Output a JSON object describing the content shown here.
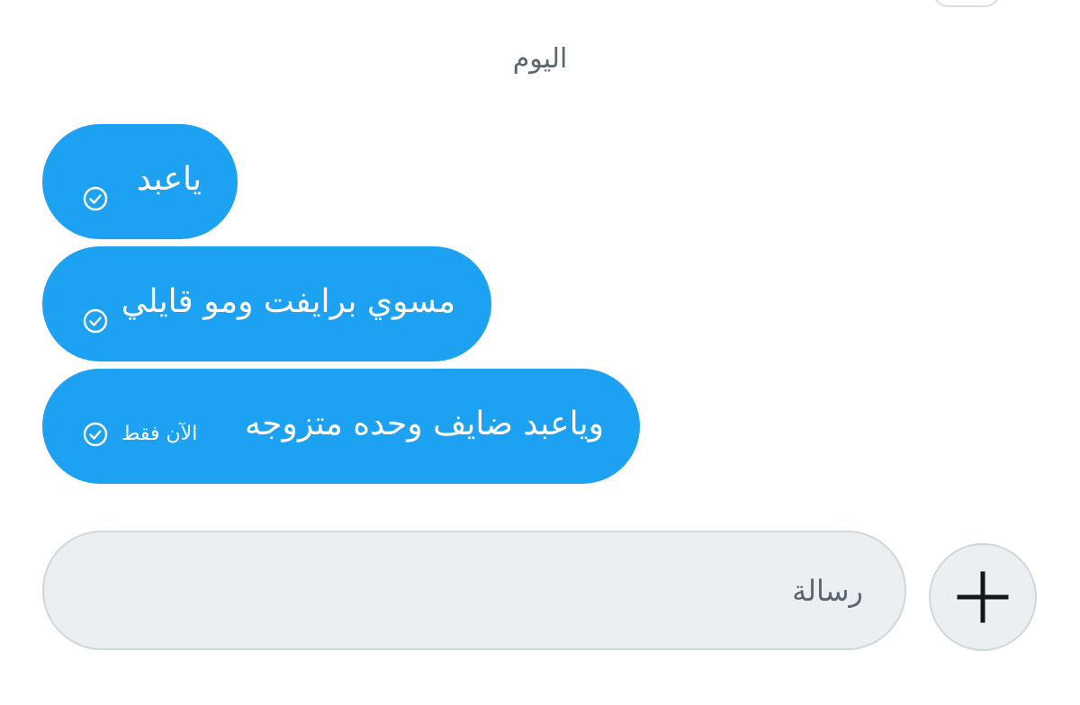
{
  "date_separator": "اليوم",
  "messages": [
    {
      "text": "ياعبد",
      "status_icon": "check-circle-icon",
      "time": ""
    },
    {
      "text": "مسوي برايفت ومو قايلي",
      "status_icon": "check-circle-icon",
      "time": ""
    },
    {
      "text": "وياعبد ضايف وحده متزوجه",
      "status_icon": "check-circle-icon",
      "time": "الآن فقط"
    }
  ],
  "composer": {
    "placeholder": "رسالة",
    "add_icon": "plus-icon"
  },
  "colors": {
    "bubble": "#1da1f2",
    "bubble_text": "#ffffff",
    "composer_bg": "#eceff1",
    "composer_border": "#cfd6dc",
    "muted_text": "#5b6770"
  }
}
